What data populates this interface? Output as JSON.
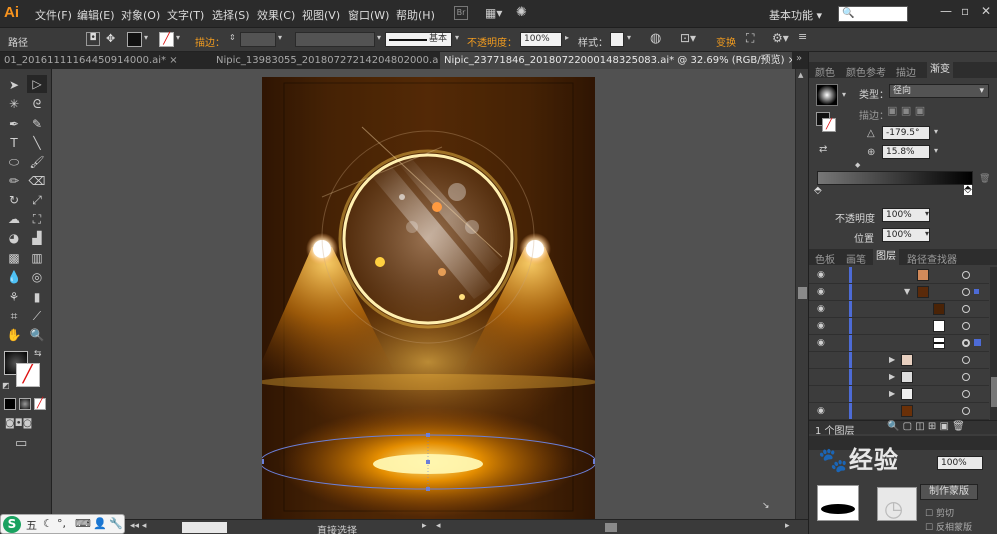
{
  "app": {
    "logo": "Ai"
  },
  "menu": [
    "文件(F)",
    "编辑(E)",
    "对象(O)",
    "文字(T)",
    "选择(S)",
    "效果(C)",
    "视图(V)",
    "窗口(W)",
    "帮助(H)"
  ],
  "workspace": "基本功能",
  "controlbar": {
    "mode_label": "路径",
    "stroke_label": "描边：",
    "basic_label": "基本",
    "opacity_label": "不透明度：",
    "opacity_value": "100%",
    "style_label": "样式：",
    "transform_label": "变换"
  },
  "tabs": [
    {
      "label": "01_20161111164450914000.ai*",
      "active": false
    },
    {
      "label": "Nipic_13983055_20180727214204802000.ai*",
      "active": false
    },
    {
      "label": "Nipic_23771846_20180722000148325083.ai* @ 32.69% (RGB/预览)",
      "active": true
    }
  ],
  "status": {
    "tool": "直接选择"
  },
  "gradient_panel": {
    "tabs": [
      "颜色",
      "颜色参考",
      "描边",
      "渐变"
    ],
    "type_label": "类型：",
    "type_value": "径向",
    "stroke_label": "描边：",
    "angle_value": "-179.5°",
    "aspect_value": "15.8%",
    "opacity_label": "不透明度",
    "opacity_value": "100%",
    "position_label": "位置",
    "position_value": "100%"
  },
  "layers_panel": {
    "tabs": [
      "色板",
      "画笔",
      "图层",
      "路径查找器"
    ],
    "footer": "1 个图层"
  },
  "bottom_panel": {
    "opacity_value": "100%",
    "mask_button": "制作蒙版",
    "cut_label": "剪切",
    "invert_label": "反相蒙版"
  },
  "ime": {
    "logo": "S",
    "mode": "五"
  },
  "watermark": "经验",
  "colors": {
    "accent": "#f29c1f",
    "glow": "#ffb000",
    "panel": "#3c3c3c"
  }
}
